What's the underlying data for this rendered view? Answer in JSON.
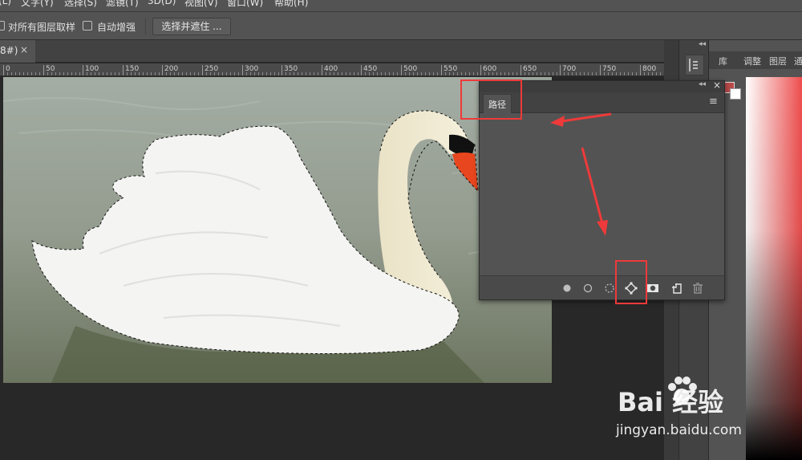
{
  "menubar": {
    "items": [
      "(L)",
      "文字(Y)",
      "选择(S)",
      "滤镜(T)",
      "3D(D)",
      "视图(V)",
      "窗口(W)",
      "帮助(H)"
    ]
  },
  "options": {
    "sample_all_layers": "对所有图层取样",
    "auto_enhance": "自动增强",
    "select_and_mask": "选择并遮住 ..."
  },
  "document": {
    "tab_label": "8#)",
    "tab_close": "×"
  },
  "ruler": {
    "labels": [
      "0",
      "50",
      "100",
      "150",
      "200",
      "250",
      "300",
      "350",
      "400",
      "450",
      "500",
      "550",
      "600",
      "650",
      "700",
      "750",
      "800"
    ]
  },
  "right_panels": {
    "tabs": [
      "库",
      "调整",
      "图层",
      "通"
    ]
  },
  "paths_panel": {
    "tab_label": "路径",
    "menu_icon": "≡",
    "close": "×",
    "collapse": "◂◂",
    "footer_buttons": [
      "fill-path-icon",
      "stroke-path-icon",
      "load-path-as-selection-icon",
      "make-work-path-from-selection-icon",
      "add-mask-icon",
      "create-new-path-icon",
      "delete-path-icon"
    ]
  },
  "dock": {
    "collapse": "◂◂"
  },
  "watermark": {
    "logo": "Bai 经验",
    "url": "jingyan.baidu.com"
  },
  "colors": {
    "annotation_red": "#ee3a3a",
    "foreground_swatch": "#b94a4a"
  }
}
